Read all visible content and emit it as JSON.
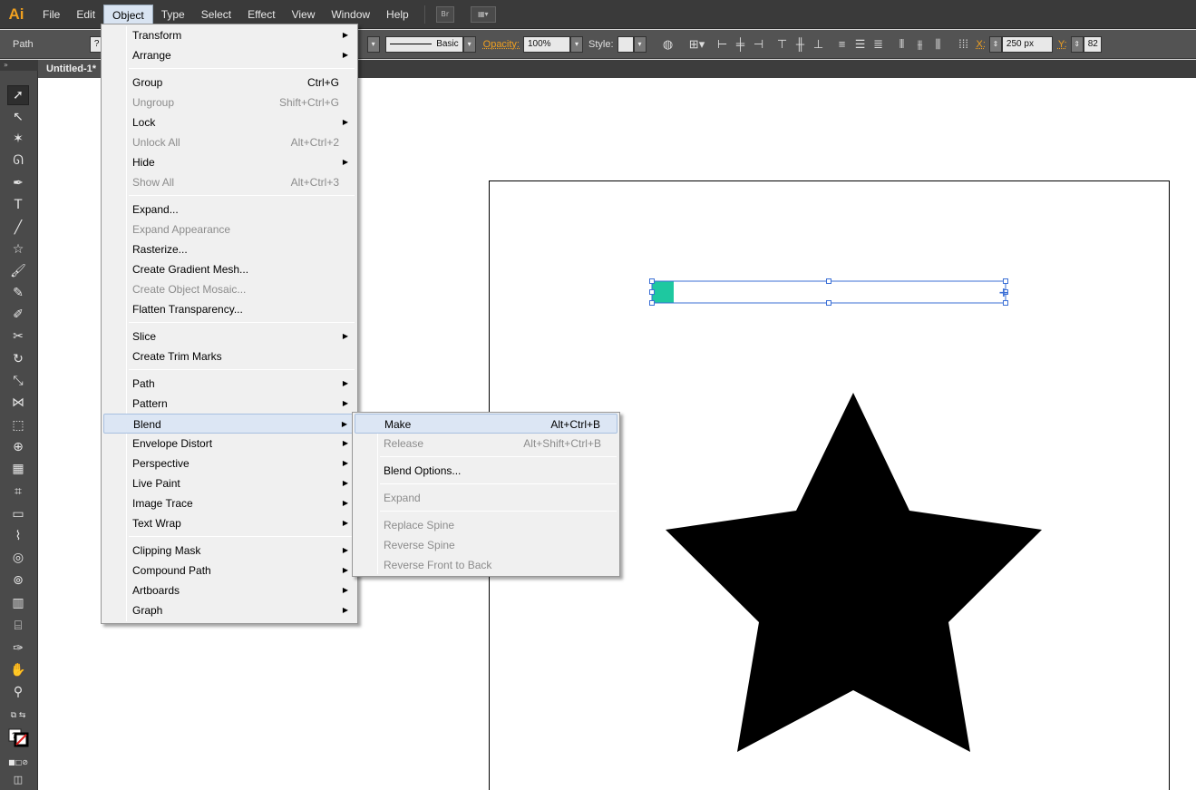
{
  "app": {
    "logo": "Ai"
  },
  "menubar": {
    "items": [
      "File",
      "Edit",
      "Object",
      "Type",
      "Select",
      "Effect",
      "View",
      "Window",
      "Help"
    ],
    "active": "Object",
    "bridge_label": "Br"
  },
  "controlbar": {
    "selection_type": "Path",
    "stroke_profile": "Basic",
    "opacity_label": "Opacity:",
    "opacity_value": "100%",
    "style_label": "Style:",
    "x_label": "X:",
    "x_value": "250 px",
    "y_label": "Y:",
    "y_value": "82"
  },
  "document": {
    "tab_title": "Untitled-1*"
  },
  "object_menu": {
    "items": [
      {
        "label": "Transform",
        "shortcut": "",
        "submenu": true,
        "disabled": false
      },
      {
        "label": "Arrange",
        "shortcut": "",
        "submenu": true,
        "disabled": false
      },
      {
        "sep": true
      },
      {
        "label": "Group",
        "shortcut": "Ctrl+G",
        "submenu": false,
        "disabled": false
      },
      {
        "label": "Ungroup",
        "shortcut": "Shift+Ctrl+G",
        "submenu": false,
        "disabled": true
      },
      {
        "label": "Lock",
        "shortcut": "",
        "submenu": true,
        "disabled": false
      },
      {
        "label": "Unlock All",
        "shortcut": "Alt+Ctrl+2",
        "submenu": false,
        "disabled": true
      },
      {
        "label": "Hide",
        "shortcut": "",
        "submenu": true,
        "disabled": false
      },
      {
        "label": "Show All",
        "shortcut": "Alt+Ctrl+3",
        "submenu": false,
        "disabled": true
      },
      {
        "sep": true
      },
      {
        "label": "Expand...",
        "shortcut": "",
        "submenu": false,
        "disabled": false
      },
      {
        "label": "Expand Appearance",
        "shortcut": "",
        "submenu": false,
        "disabled": true
      },
      {
        "label": "Rasterize...",
        "shortcut": "",
        "submenu": false,
        "disabled": false
      },
      {
        "label": "Create Gradient Mesh...",
        "shortcut": "",
        "submenu": false,
        "disabled": false
      },
      {
        "label": "Create Object Mosaic...",
        "shortcut": "",
        "submenu": false,
        "disabled": true
      },
      {
        "label": "Flatten Transparency...",
        "shortcut": "",
        "submenu": false,
        "disabled": false
      },
      {
        "sep": true
      },
      {
        "label": "Slice",
        "shortcut": "",
        "submenu": true,
        "disabled": false
      },
      {
        "label": "Create Trim Marks",
        "shortcut": "",
        "submenu": false,
        "disabled": false
      },
      {
        "sep": true
      },
      {
        "label": "Path",
        "shortcut": "",
        "submenu": true,
        "disabled": false
      },
      {
        "label": "Pattern",
        "shortcut": "",
        "submenu": true,
        "disabled": false
      },
      {
        "label": "Blend",
        "shortcut": "",
        "submenu": true,
        "disabled": false,
        "highlighted": true
      },
      {
        "label": "Envelope Distort",
        "shortcut": "",
        "submenu": true,
        "disabled": false
      },
      {
        "label": "Perspective",
        "shortcut": "",
        "submenu": true,
        "disabled": false
      },
      {
        "label": "Live Paint",
        "shortcut": "",
        "submenu": true,
        "disabled": false
      },
      {
        "label": "Image Trace",
        "shortcut": "",
        "submenu": true,
        "disabled": false
      },
      {
        "label": "Text Wrap",
        "shortcut": "",
        "submenu": true,
        "disabled": false
      },
      {
        "sep": true
      },
      {
        "label": "Clipping Mask",
        "shortcut": "",
        "submenu": true,
        "disabled": false
      },
      {
        "label": "Compound Path",
        "shortcut": "",
        "submenu": true,
        "disabled": false
      },
      {
        "label": "Artboards",
        "shortcut": "",
        "submenu": true,
        "disabled": false
      },
      {
        "label": "Graph",
        "shortcut": "",
        "submenu": true,
        "disabled": false
      }
    ]
  },
  "blend_submenu": {
    "items": [
      {
        "label": "Make",
        "shortcut": "Alt+Ctrl+B",
        "disabled": false,
        "highlighted": true
      },
      {
        "label": "Release",
        "shortcut": "Alt+Shift+Ctrl+B",
        "disabled": true
      },
      {
        "sep": true
      },
      {
        "label": "Blend Options...",
        "shortcut": "",
        "disabled": false
      },
      {
        "sep": true
      },
      {
        "label": "Expand",
        "shortcut": "",
        "disabled": true
      },
      {
        "sep": true
      },
      {
        "label": "Replace Spine",
        "shortcut": "",
        "disabled": true
      },
      {
        "label": "Reverse Spine",
        "shortcut": "",
        "disabled": true
      },
      {
        "label": "Reverse Front to Back",
        "shortcut": "",
        "disabled": true
      }
    ]
  },
  "colors": {
    "selection": "#3b6fd6",
    "square_fill": "#1ec8a0",
    "star_fill": "#000000"
  }
}
